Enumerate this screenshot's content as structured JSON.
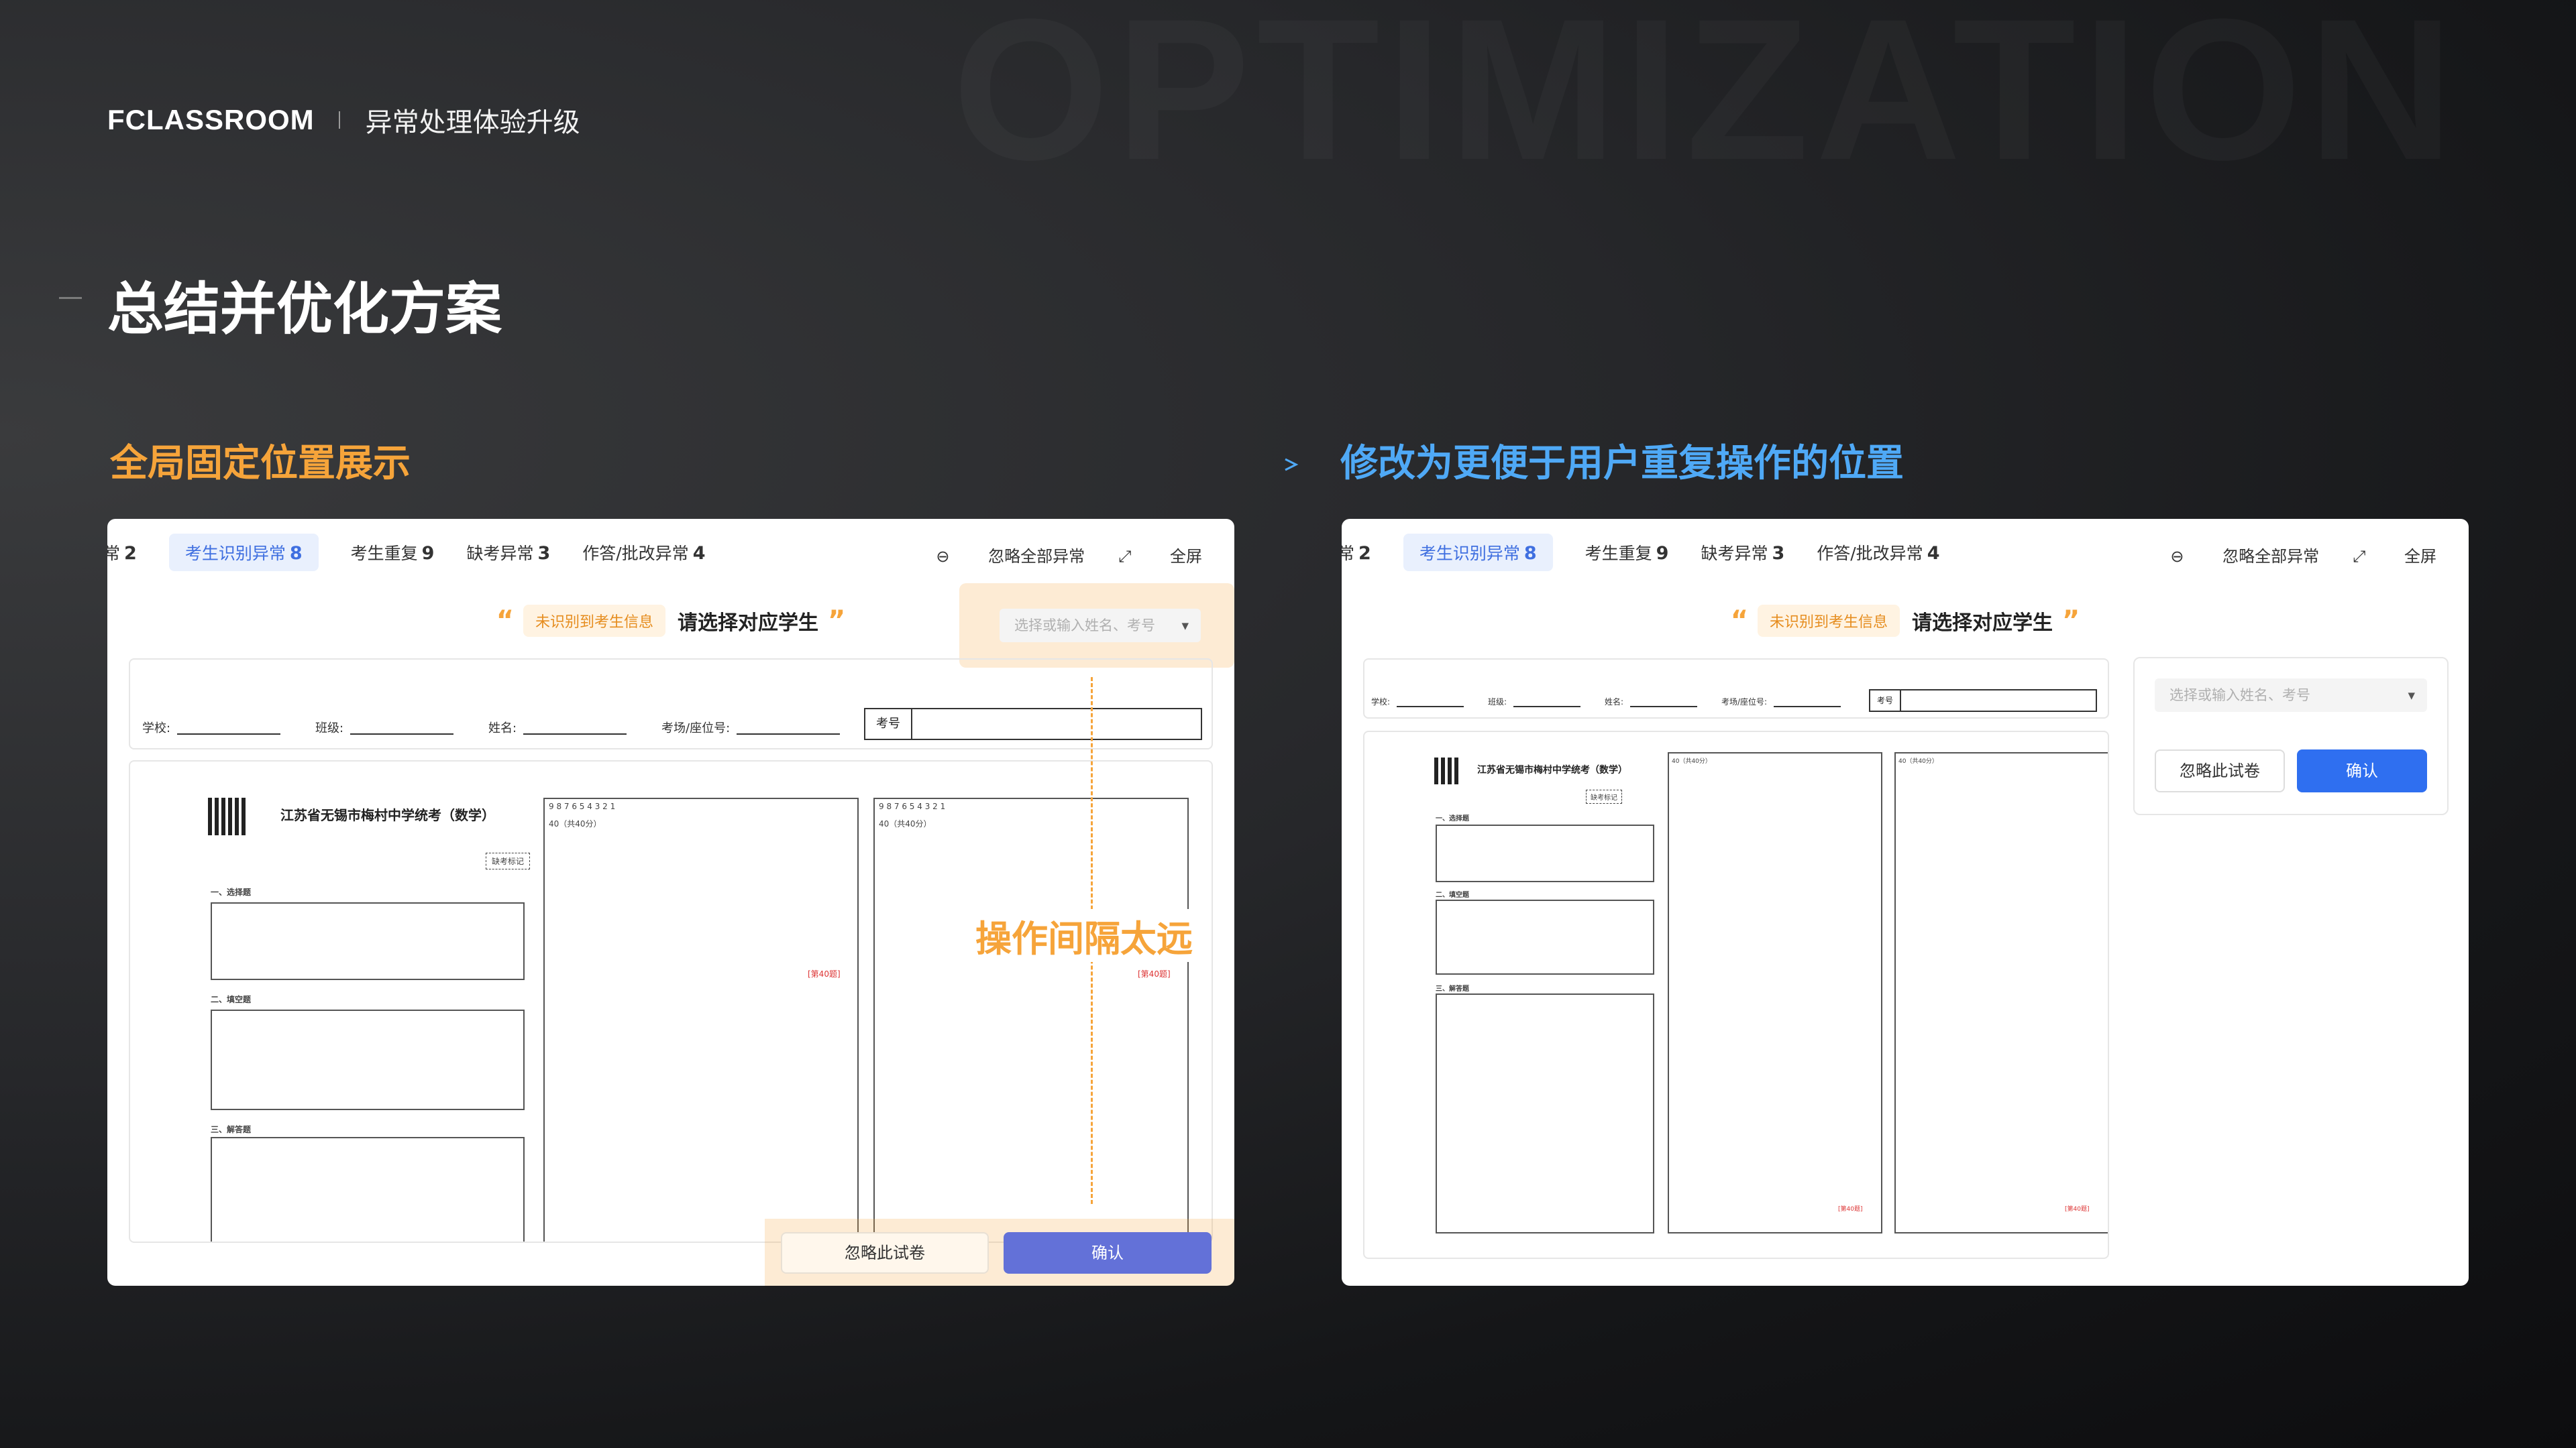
{
  "header": {
    "background_word": "OPTIMIZATION",
    "brand": "FCLASSROOM",
    "subtitle": "异常处理体验升级"
  },
  "page_title": "总结并优化方案",
  "comparison": {
    "left_label": "全局固定位置展示",
    "right_label": "修改为更便于用户重复操作的位置",
    "accent_left": "#f6a43a",
    "accent_right": "#4fa9f6"
  },
  "panel": {
    "tabs": [
      {
        "label": "常",
        "count": "2"
      },
      {
        "label": "考生识别异常",
        "count": "8"
      },
      {
        "label": "考生重复",
        "count": "9"
      },
      {
        "label": "缺考异常",
        "count": "3"
      },
      {
        "label": "作答/批改异常",
        "count": "4"
      }
    ],
    "ignore_all": "忽略全部异常",
    "fullscreen": "全屏",
    "badge": "未识别到考生信息",
    "prompt": "请选择对应学生",
    "select_placeholder": "选择或输入姓名、考号",
    "fields": {
      "school": "学校:",
      "class": "班级:",
      "name": "姓名:",
      "seat": "考场/座位号:",
      "exam_no": "考号"
    },
    "sheet": {
      "title": "江苏省无锡市梅村中学统考（数学）",
      "absent_mark": "缺考标记",
      "section_choice": "一、选择题",
      "section_fill": "二、填空题",
      "section_answer": "三、解答题",
      "score_label": "40（共40分）",
      "question_tag": "[第40题]",
      "digits": "9 8 7 6 5 4 3 2 1"
    },
    "ignore_button": "忽略此试卷",
    "confirm_button": "确认",
    "annotation": "操作间隔太远",
    "confirm_color_left": "#6371d8",
    "confirm_color_right": "#2f6ff0"
  }
}
